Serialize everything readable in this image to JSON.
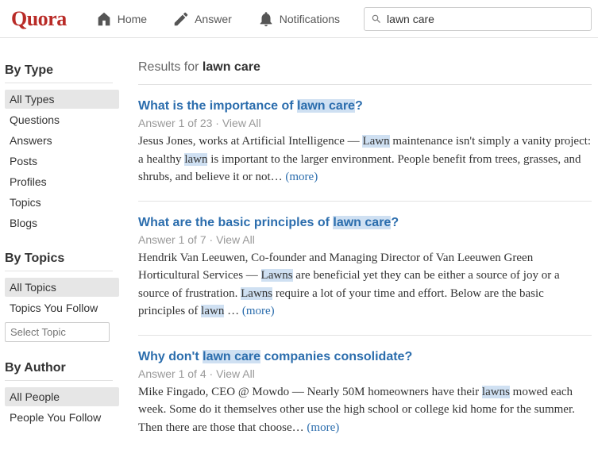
{
  "header": {
    "logo": "Quora",
    "nav": {
      "home": "Home",
      "answer": "Answer",
      "notifications": "Notifications"
    },
    "search_value": "lawn care"
  },
  "sidebar": {
    "by_type": {
      "title": "By Type",
      "items": [
        "All Types",
        "Questions",
        "Answers",
        "Posts",
        "Profiles",
        "Topics",
        "Blogs"
      ],
      "active": 0
    },
    "by_topics": {
      "title": "By Topics",
      "items": [
        "All Topics",
        "Topics You Follow"
      ],
      "active": 0,
      "placeholder": "Select Topic"
    },
    "by_author": {
      "title": "By Author",
      "items": [
        "All People",
        "People You Follow"
      ],
      "active": 0
    }
  },
  "results_header": {
    "prefix": "Results for ",
    "query": "lawn care"
  },
  "results": [
    {
      "title_pre": "What is the importance of ",
      "title_hl": "lawn care",
      "title_post": "?",
      "meta": "Answer 1 of 23",
      "view_all": "View All",
      "body_pre": "Jesus Jones, works at Artificial Intelligence — ",
      "body_hl1": "Lawn",
      "body_mid1": " maintenance isn't simply a vanity project: a healthy ",
      "body_hl2": "lawn",
      "body_mid2": " is important to the larger environment. People benefit from trees, grasses, and shrubs, and believe it or not… ",
      "more": "(more)"
    },
    {
      "title_pre": "What are the basic principles of ",
      "title_hl": "lawn care",
      "title_post": "?",
      "meta": "Answer 1 of 7",
      "view_all": "View All",
      "body_pre": "Hendrik Van Leeuwen, Co-founder and Managing Director of Van Leeuwen Green Horticultural Services — ",
      "body_hl1": "Lawns",
      "body_mid1": " are beneficial yet they can be either a source of joy or a source of frustration. ",
      "body_hl2": "Lawns",
      "body_mid2": " require a lot of your time and effort. Below are the basic principles of ",
      "body_hl3": "lawn",
      "body_mid3": " … ",
      "more": "(more)"
    },
    {
      "title_pre": "Why don't ",
      "title_hl": "lawn care",
      "title_post": " companies consolidate?",
      "meta": "Answer 1 of 4",
      "view_all": "View All",
      "body_pre": "Mike Fingado, CEO @ Mowdo — Nearly 50M homeowners have their ",
      "body_hl1": "lawns",
      "body_mid1": " mowed each week. Some do it themselves other use the high school or college kid home for the summer. Then there are those that choose… ",
      "more": "(more)"
    }
  ]
}
